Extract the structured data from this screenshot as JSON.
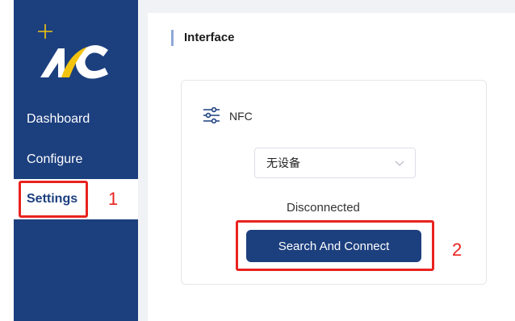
{
  "sidebar": {
    "items": [
      {
        "label": "Dashboard"
      },
      {
        "label": "Configure"
      },
      {
        "label": "Settings",
        "active": true
      }
    ],
    "background_color": "#1c3f7e"
  },
  "main": {
    "panel_title": "Interface",
    "card": {
      "title": "NFC",
      "device_select": {
        "value": "无设备"
      },
      "status": "Disconnected",
      "connect_button_label": "Search And Connect"
    }
  },
  "annotations": [
    {
      "number": "1",
      "target": "Settings"
    },
    {
      "number": "2",
      "target": "Search And Connect"
    }
  ],
  "colors": {
    "accent": "#1c3f7e",
    "annotation": "#e8231f",
    "logo_yellow": "#f2c40f"
  }
}
